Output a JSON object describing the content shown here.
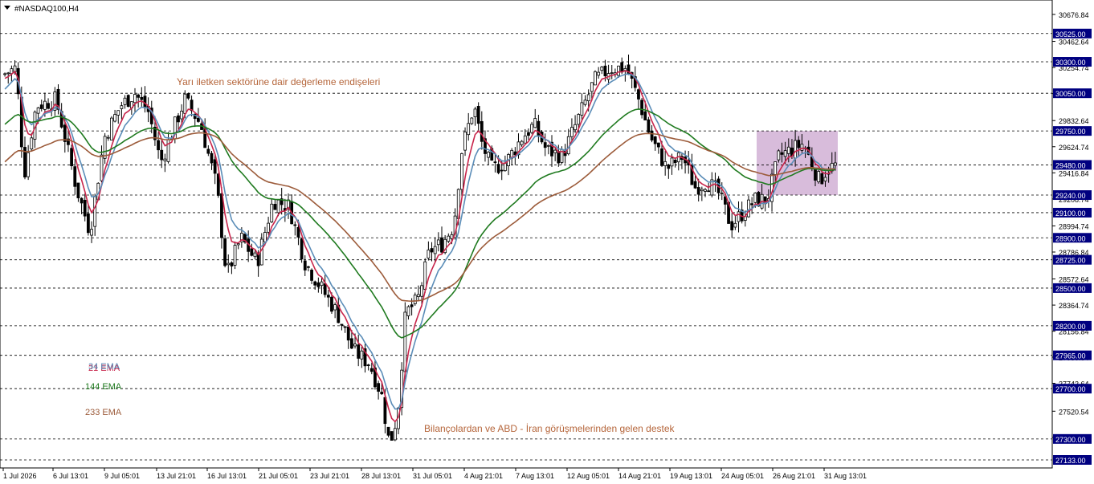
{
  "window": {
    "title": "#NASDAQ100,H4"
  },
  "annotations": {
    "top": "Yarı iletken sektörüne dair değerleme endişeleri",
    "bottom": "Bilançolardan ve ABD - İran görüşmelerinden gelen destek"
  },
  "legend": [
    {
      "label": "21 EMA",
      "color": "#c8254b"
    },
    {
      "label": "34 EMA",
      "color": "#5b8db8"
    },
    {
      "label": "144 EMA",
      "color": "#1f7a1f"
    },
    {
      "label": "233 EMA",
      "color": "#9c5b3a"
    }
  ],
  "colors": {
    "annotation": "#b5653a",
    "candle": "#000000",
    "grid": "#000000",
    "level_box": "#000080",
    "level_text": "#ffffff",
    "zone": "#c8a0cc"
  },
  "chart_data": {
    "type": "candlestick",
    "symbol": "#NASDAQ100",
    "timeframe": "H4",
    "ylim": [
      27133.0,
      30676.84
    ],
    "y_ticks": [
      "30676.84",
      "30462.64",
      "30254.74",
      "30046.84",
      "29832.64",
      "29624.74",
      "29416.84",
      "29208.74",
      "28994.74",
      "28786.84",
      "28572.64",
      "28364.74",
      "28156.84",
      "27950.54",
      "27742.64",
      "27520.54",
      "27312.64"
    ],
    "levels": [
      "30525.00",
      "30300.00",
      "30050.00",
      "29750.00",
      "29480.00",
      "29240.00",
      "29100.00",
      "28900.00",
      "28725.00",
      "28500.00",
      "28200.00",
      "27965.00",
      "27700.00",
      "27300.00",
      "27133.00"
    ],
    "x_ticks": [
      "1 Jul 2026",
      "6 Jul 13:01",
      "9 Jul 05:01",
      "13 Jul 21:01",
      "16 Jul 13:01",
      "21 Jul 05:01",
      "23 Jul 21:01",
      "28 Jul 13:01",
      "31 Jul 05:01",
      "4 Aug 21:01",
      "7 Aug 13:01",
      "12 Aug 05:01",
      "14 Aug 21:01",
      "19 Aug 13:01",
      "24 Aug 05:01",
      "26 Aug 21:01",
      "31 Aug 13:01"
    ],
    "approx_close_path": [
      {
        "t": "1 Jul 2026",
        "close": 30150
      },
      {
        "t": "6 Jul 13:01",
        "close": 29900
      },
      {
        "t": "9 Jul 05:01",
        "close": 29800
      },
      {
        "t": "13 Jul 21:01",
        "close": 29950
      },
      {
        "t": "16 Jul 13:01",
        "close": 28800
      },
      {
        "t": "21 Jul 05:01",
        "close": 29200
      },
      {
        "t": "23 Jul 21:01",
        "close": 28500
      },
      {
        "t": "28 Jul 13:01",
        "close": 27700
      },
      {
        "t": "31 Jul 05:01",
        "close": 28500
      },
      {
        "t": "4 Aug 21:01",
        "close": 29500
      },
      {
        "t": "7 Aug 13:01",
        "close": 29800
      },
      {
        "t": "12 Aug 05:01",
        "close": 30100
      },
      {
        "t": "14 Aug 21:01",
        "close": 29800
      },
      {
        "t": "19 Aug 13:01",
        "close": 29350
      },
      {
        "t": "24 Aug 05:01",
        "close": 29300
      },
      {
        "t": "26 Aug 21:01",
        "close": 29600
      },
      {
        "t": "31 Aug 13:01",
        "close": 29480
      }
    ],
    "series": [
      {
        "name": "21 EMA"
      },
      {
        "name": "34 EMA"
      },
      {
        "name": "144 EMA"
      },
      {
        "name": "233 EMA"
      }
    ],
    "zone": {
      "from": "26 Aug 21:01",
      "to": "31 Aug 13:01",
      "y_low": 29240.0,
      "y_high": 29750.0
    }
  }
}
